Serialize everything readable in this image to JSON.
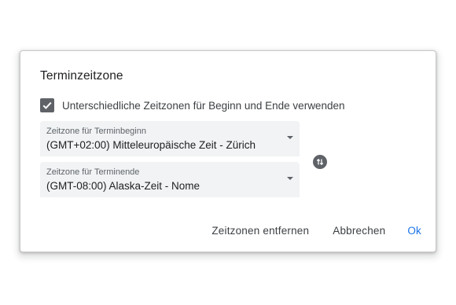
{
  "dialog": {
    "title": "Terminzeitzone",
    "checkbox": {
      "label": "Unterschiedliche Zeitzonen für Beginn und Ende verwenden",
      "checked": true
    },
    "start_timezone": {
      "caption": "Zeitzone für Terminbeginn",
      "value": "(GMT+02:00) Mitteleuropäische Zeit - Zürich"
    },
    "end_timezone": {
      "caption": "Zeitzone für Terminende",
      "value": "(GMT-08:00) Alaska-Zeit - Nome"
    },
    "swap_icon": "swap-vertical-icon",
    "buttons": {
      "remove_label": "Zeitzonen entfernen",
      "cancel_label": "Abbrechen",
      "ok_label": "Ok"
    }
  },
  "colors": {
    "accent": "#1a73e8",
    "checkbox": "#5f6368",
    "field_background": "#f1f3f4"
  }
}
